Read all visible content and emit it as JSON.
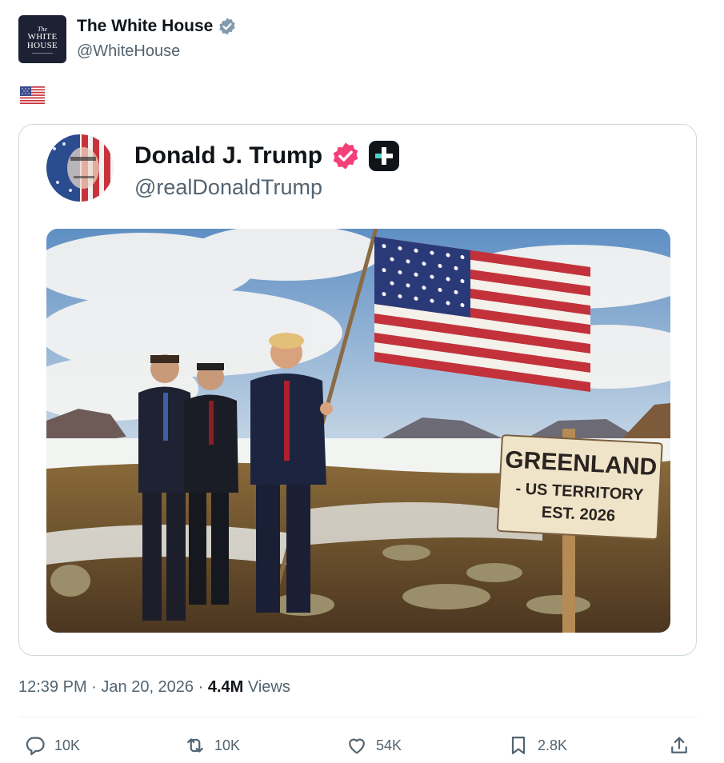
{
  "author": {
    "name": "The White House",
    "handle": "@WhiteHouse",
    "avatar_text_small": "The",
    "avatar_text_line1": "WHITE",
    "avatar_text_line2": "HOUSE",
    "verified_color": "#829aab"
  },
  "post": {
    "text_emoji": "🇺🇸"
  },
  "quoted": {
    "name": "Donald J. Trump",
    "handle": "@realDonaldTrump",
    "verified_color": "#f4407a",
    "sign_lines": [
      "GREENLAND",
      "- US TERRITORY",
      "EST. 2026"
    ]
  },
  "meta": {
    "time": "12:39 PM",
    "date": "Jan 20, 2026",
    "views_count": "4.4M",
    "views_label": "Views"
  },
  "actions": {
    "reply": "10K",
    "repost": "10K",
    "like": "54K",
    "bookmark": "2.8K"
  }
}
